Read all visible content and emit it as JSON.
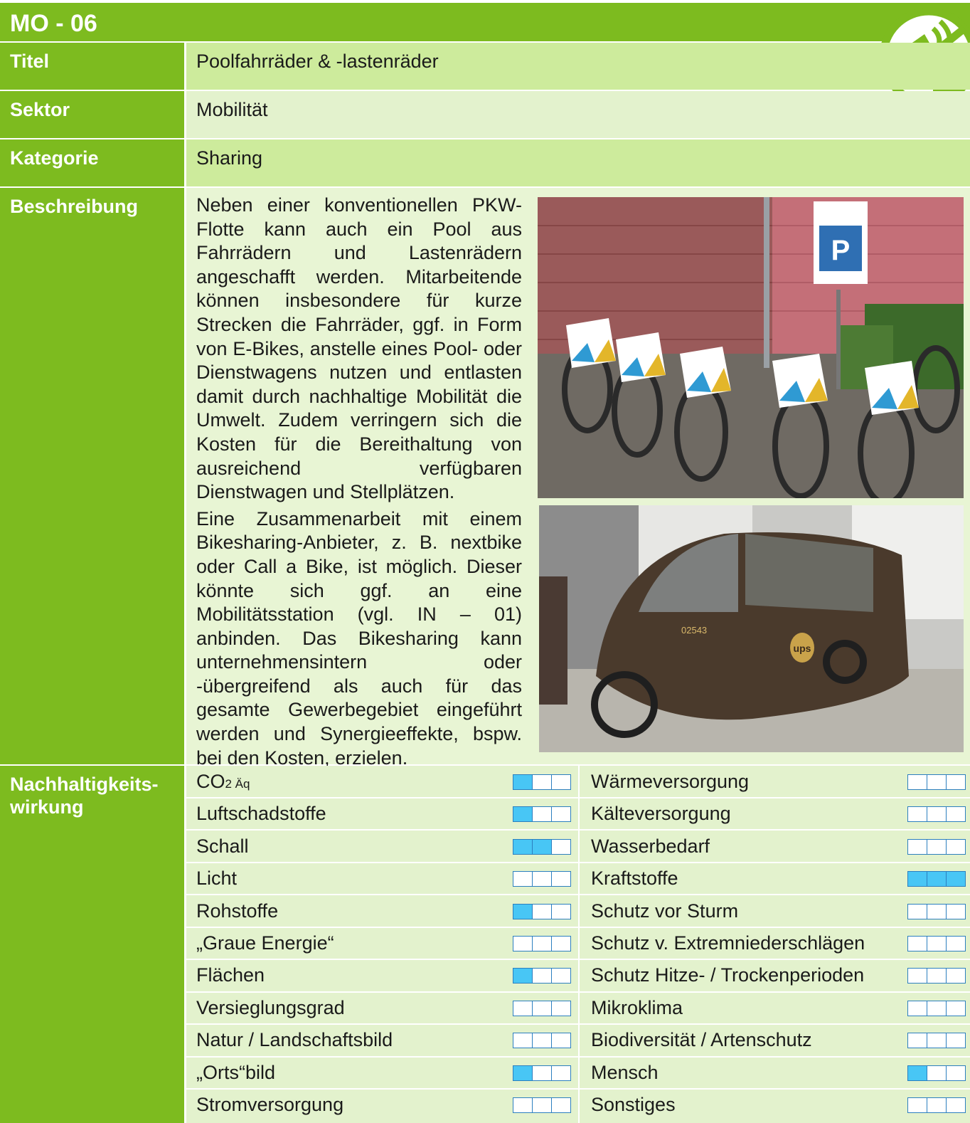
{
  "code": "MO - 06",
  "fields": {
    "titel": {
      "label": "Titel",
      "value": "Poolfahrräder & -lastenräder"
    },
    "sektor": {
      "label": "Sektor",
      "value": "Mobilität"
    },
    "kategorie": {
      "label": "Kategorie",
      "value": "Sharing"
    },
    "beschreibung": {
      "label": "Beschreibung"
    }
  },
  "description": {
    "p1": "Neben einer konventionellen PKW-Flotte kann auch ein Pool aus Fahrrädern und Lastenrädern angeschafft werden. Mitarbeitende können insbesondere für kurze Strecken die Fahrräder, ggf. in Form von E-Bikes, anstelle eines Pool- oder Dienstwagens nutzen und entlasten damit durch nachhaltige Mobilität die Umwelt. Zudem verringern sich die Kosten für die Bereithaltung von ausreichend verfügbaren Dienstwagen und Stellplätzen.",
    "p2": "Eine Zusammenarbeit mit einem Bikesharing-Anbieter, z. B. nextbike oder Call a Bike, ist möglich. Dieser könnte sich ggf. an eine Mobilitätsstation (vgl. IN – 01) anbinden. Das Bikesharing kann unternehmensintern oder -übergreifend als auch für das gesamte Gewerbegebiet eingeführt werden und Synergieeffekte, bspw. bei den Kosten, erzielen."
  },
  "photos": {
    "bikes_sign": "P",
    "cargo_number": "02543",
    "cargo_brand": "ups"
  },
  "impact": {
    "label": "Nachhaltigkeitswirkung",
    "label_line1": "Nachhaltigkeits-",
    "label_line2": "wirkung",
    "left": [
      {
        "name": "CO",
        "sub": "2 Äq",
        "level": 1
      },
      {
        "name": "Luftschadstoffe",
        "level": 1
      },
      {
        "name": "Schall",
        "level": 2
      },
      {
        "name": "Licht",
        "level": 0
      },
      {
        "name": "Rohstoffe",
        "level": 1
      },
      {
        "name": "„Graue Energie“",
        "level": 0
      },
      {
        "name": "Flächen",
        "level": 1
      },
      {
        "name": "Versieglungsgrad",
        "level": 0
      },
      {
        "name": "Natur / Landschaftsbild",
        "level": 0
      },
      {
        "name": "„Orts“bild",
        "level": 1
      },
      {
        "name": "Stromversorgung",
        "level": 0
      }
    ],
    "right": [
      {
        "name": "Wärmeversorgung",
        "level": 0
      },
      {
        "name": "Kälteversorgung",
        "level": 0
      },
      {
        "name": "Wasserbedarf",
        "level": 0
      },
      {
        "name": "Kraftstoffe",
        "level": 3
      },
      {
        "name": "Schutz vor Sturm",
        "level": 0
      },
      {
        "name": "Schutz v. Extremniederschlägen",
        "level": 0
      },
      {
        "name": "Schutz Hitze- / Trockenperioden",
        "level": 0
      },
      {
        "name": "Mikroklima",
        "level": 0
      },
      {
        "name": "Biodiversität / Artenschutz",
        "level": 0
      },
      {
        "name": "Mensch",
        "level": 1
      },
      {
        "name": "Sonstiges",
        "level": 0
      }
    ]
  },
  "colors": {
    "green": "#7dbb1f",
    "light": "#e3f2cd",
    "lighter": "#cdeb9c",
    "blue": "#48c6f5"
  }
}
